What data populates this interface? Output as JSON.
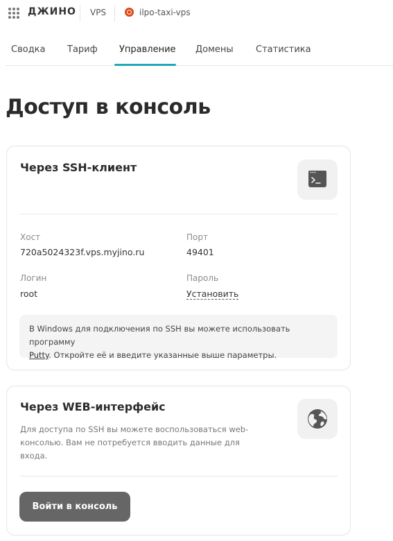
{
  "header": {
    "logo": "ДЖИНО",
    "service": "VPS",
    "server_name": "ilpo-taxi-vps"
  },
  "tabs": [
    {
      "label": "Сводка",
      "active": false
    },
    {
      "label": "Тариф",
      "active": false
    },
    {
      "label": "Управление",
      "active": true
    },
    {
      "label": "Домены",
      "active": false
    },
    {
      "label": "Статистика",
      "active": false
    }
  ],
  "page": {
    "title": "Доступ в консоль"
  },
  "ssh": {
    "title": "Через SSH-клиент",
    "host_label": "Хост",
    "host_value": "720a5024323f.vps.myjino.ru",
    "port_label": "Порт",
    "port_value": "49401",
    "login_label": "Логин",
    "login_value": "root",
    "password_label": "Пароль",
    "password_link": "Установить",
    "note_line1": "В Windows для подключения по SSH вы можете использовать программу",
    "note_putty": "Putty",
    "note_rest": ". Откройте её и введите указанные выше параметры."
  },
  "web": {
    "title": "Через WEB-интерфейс",
    "description": "Для доступа по SSH вы можете воспользоваться web-консолью. Вам не потребуется вводить данные для входа.",
    "button_label": "Войти в консоль"
  },
  "colors": {
    "accent": "#1fa8b8",
    "button": "#666666",
    "ubuntu": "#dd4814"
  }
}
